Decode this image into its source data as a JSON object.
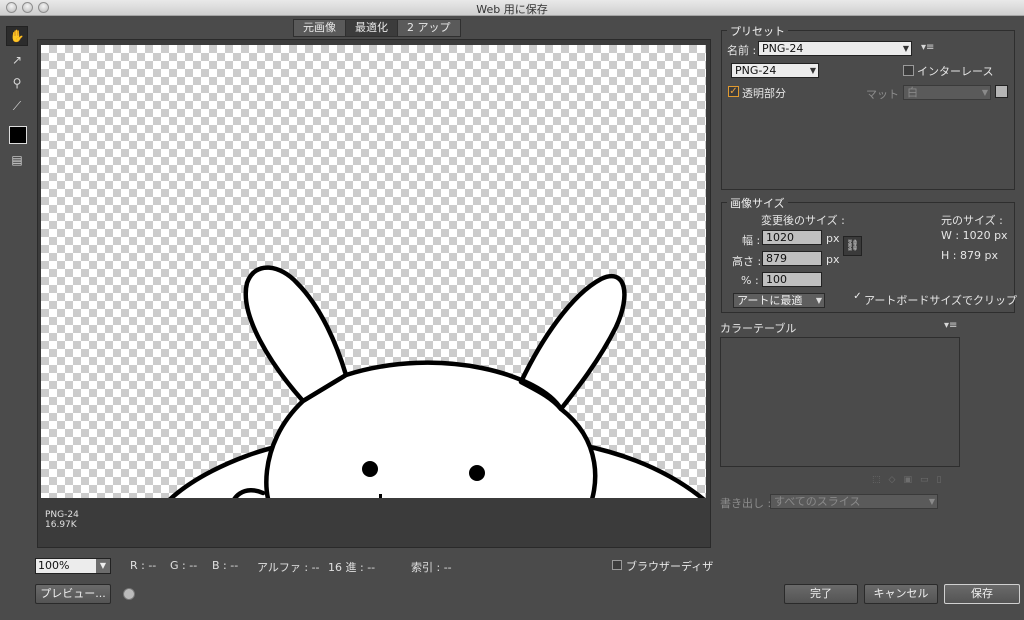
{
  "window": {
    "title": "Web 用に保存"
  },
  "tools": [
    {
      "name": "hand-tool-icon",
      "glyph": "✋"
    },
    {
      "name": "slice-select-tool-icon",
      "glyph": "↗"
    },
    {
      "name": "zoom-tool-icon",
      "glyph": "⚲"
    },
    {
      "name": "eyedropper-tool-icon",
      "glyph": "⟋"
    },
    {
      "name": "toggle-slices-icon",
      "glyph": "▤"
    }
  ],
  "view_tabs": [
    "元画像",
    "最適化",
    "2 アップ"
  ],
  "preview": {
    "format": "PNG-24",
    "size": "16.97K"
  },
  "bottom_bar": {
    "zoom": "100%",
    "r": "R : --",
    "g": "G : --",
    "b": "B : --",
    "alpha": "アルファ : --",
    "hex": "16 進 : --",
    "index": "索引 : --",
    "browser_dither": "ブラウザーディザ"
  },
  "buttons": {
    "preview": "プレビュー...",
    "done": "完了",
    "cancel": "キャンセル",
    "save": "保存"
  },
  "preset": {
    "title": "プリセット",
    "name_label": "名前 :",
    "name_value": "PNG-24",
    "format_value": "PNG-24",
    "interlace": "インターレース",
    "transparency": "透明部分",
    "matte_label": "マット :",
    "matte_value": "白"
  },
  "image_size": {
    "title": "画像サイズ",
    "new_size_label": "変更後のサイズ :",
    "width_label": "幅 :",
    "width_value": "1020",
    "height_label": "高さ :",
    "height_value": "879",
    "percent_label": "% :",
    "percent_value": "100",
    "unit": "px",
    "quality_value": "アートに最適",
    "orig_label": "元のサイズ :",
    "orig_w": "W :  1020 px",
    "orig_h": "H :   879 px",
    "clip_label": "アートボードサイズでクリップ"
  },
  "color_table": {
    "title": "カラーテーブル"
  },
  "export": {
    "label": "書き出し :",
    "value": "すべてのスライス"
  },
  "colors": {
    "background": "#4b4b4b",
    "checker": "#cccccc",
    "accent_check": "#e09a30"
  }
}
